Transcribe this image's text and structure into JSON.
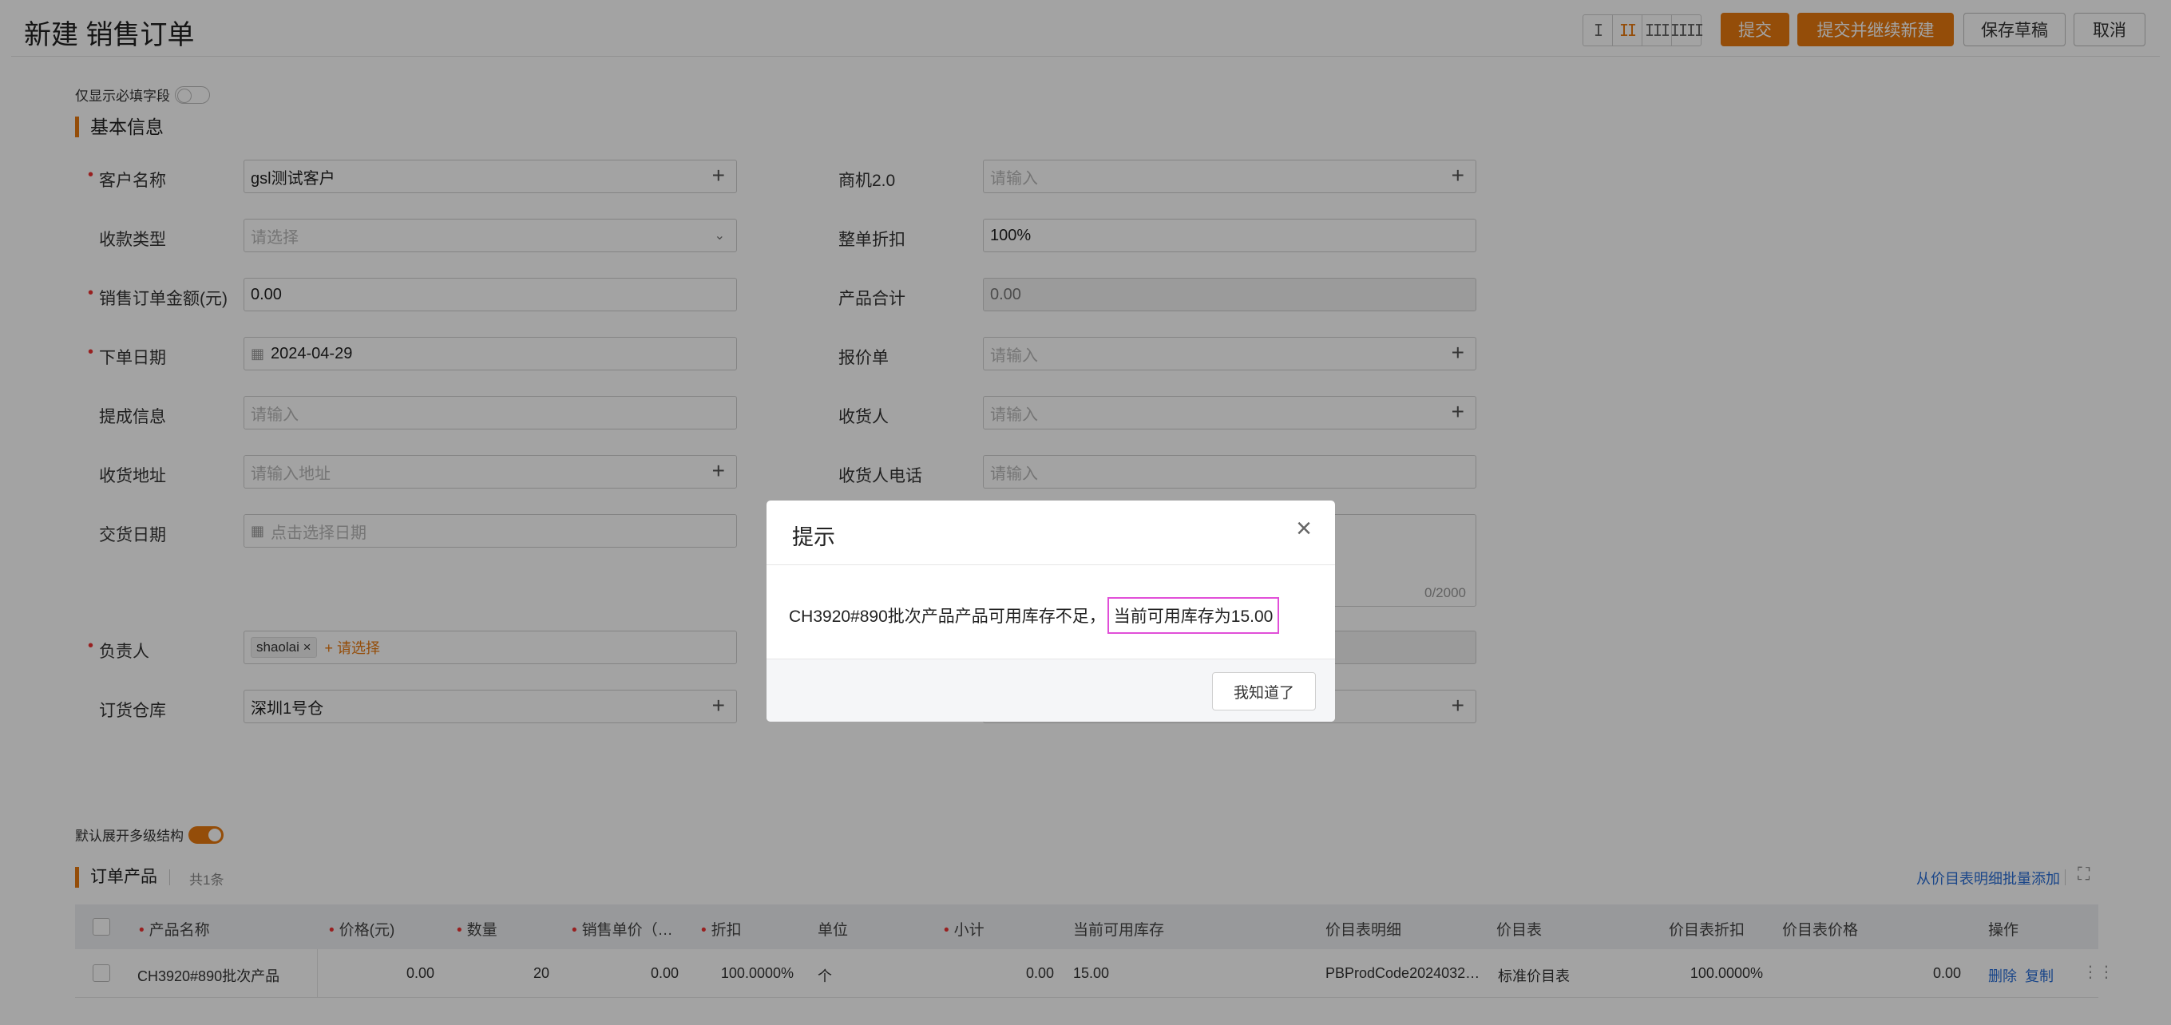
{
  "header": {
    "title": "新建 销售订单",
    "layout_options": [
      "I",
      "II",
      "III",
      "IIII"
    ],
    "buttons": {
      "submit": "提交",
      "submit_new": "提交并继续新建",
      "save_draft": "保存草稿",
      "cancel": "取消"
    }
  },
  "required_toggle_label": "仅显示必填字段",
  "basic_info": {
    "title": "基本信息",
    "customer": {
      "label": "客户名称",
      "value": "gsl测试客户"
    },
    "opportunity": {
      "label": "商机2.0",
      "placeholder": "请输入"
    },
    "payment_type": {
      "label": "收款类型",
      "placeholder": "请选择"
    },
    "discount": {
      "label": "整单折扣",
      "value": "100%"
    },
    "order_amount": {
      "label": "销售订单金额(元)",
      "value": "0.00"
    },
    "product_total": {
      "label": "产品合计",
      "value": "0.00"
    },
    "order_date": {
      "label": "下单日期",
      "value": "2024-04-29"
    },
    "quote": {
      "label": "报价单",
      "placeholder": "请输入"
    },
    "commission": {
      "label": "提成信息",
      "placeholder": "请输入"
    },
    "receiver": {
      "label": "收货人",
      "placeholder": "请输入"
    },
    "address": {
      "label": "收货地址",
      "placeholder": "请输入地址"
    },
    "receiver_phone": {
      "label": "收货人电话",
      "placeholder": "请输入"
    },
    "delivery_date": {
      "label": "交货日期",
      "placeholder": "点击选择日期"
    },
    "remark_counter": "0/2000",
    "owner": {
      "label": "负责人",
      "tag": "shaolai",
      "add": "+ 请选择"
    },
    "warehouse": {
      "label": "订货仓库",
      "value": "深圳1号仓"
    }
  },
  "expand_toggle_label": "默认展开多级结构",
  "products": {
    "title": "订单产品",
    "count": "共1条",
    "batch_add": "从价目表明细批量添加",
    "columns": [
      "产品名称",
      "价格(元)",
      "数量",
      "销售单价（…",
      "折扣",
      "单位",
      "小计",
      "当前可用库存",
      "价目表明细",
      "价目表",
      "价目表折扣",
      "价目表价格",
      "操作"
    ],
    "rows": [
      {
        "name": "CH3920#890批次产品",
        "price": "0.00",
        "qty": "20",
        "unit_price": "0.00",
        "discount": "100.0000%",
        "unit": "个",
        "subtotal": "0.00",
        "stock": "15.00",
        "pricebook_detail": "PBProdCode2024032…",
        "pricebook": "标准价目表",
        "pb_discount": "100.0000%",
        "pb_price": "0.00",
        "delete": "删除",
        "copy": "复制"
      }
    ]
  },
  "dialog": {
    "title": "提示",
    "message": "CH3920#890批次产品产品可用库存不足，",
    "highlight": "当前可用库存为15.00",
    "ok": "我知道了"
  },
  "colors": {
    "accent": "#e8790f",
    "link": "#2a6ed6",
    "highlight_border": "#e14fd8"
  }
}
